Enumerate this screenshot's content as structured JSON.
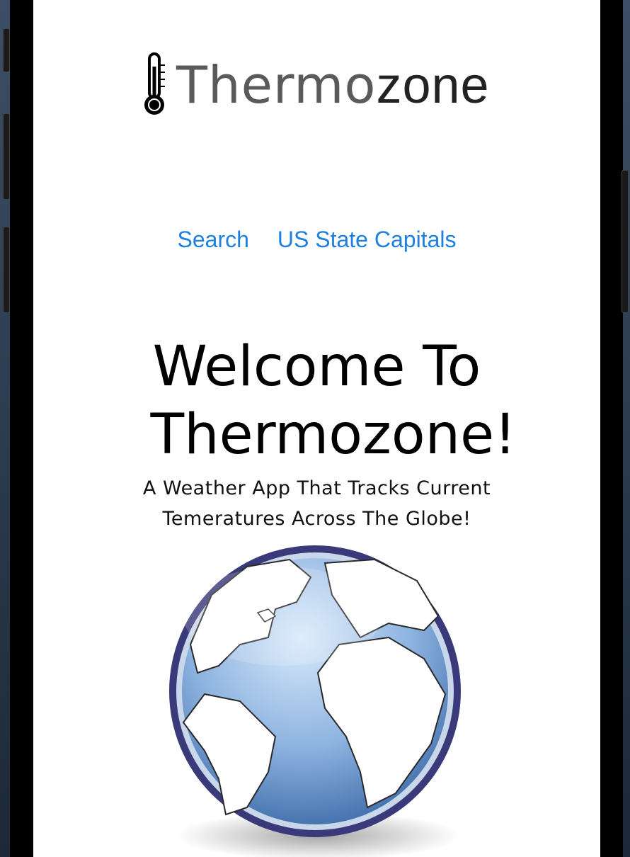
{
  "brand": {
    "logo_part1": "Thermo",
    "logo_part2": "zone",
    "icon": "thermometer-icon"
  },
  "nav": {
    "items": [
      {
        "label": "Search"
      },
      {
        "label": "US State Capitals"
      }
    ]
  },
  "hero": {
    "title": "Welcome To Thermozone!",
    "subtitle": "A Weather App That Tracks Current Temeratures Across The Globe!",
    "image": "globe-illustration"
  },
  "colors": {
    "link": "#1e7fe0",
    "title": "#000000",
    "logo_dark": "#5a5a5a",
    "globe_ocean": "#4f7fbd",
    "globe_rim": "#3a3a7a"
  }
}
